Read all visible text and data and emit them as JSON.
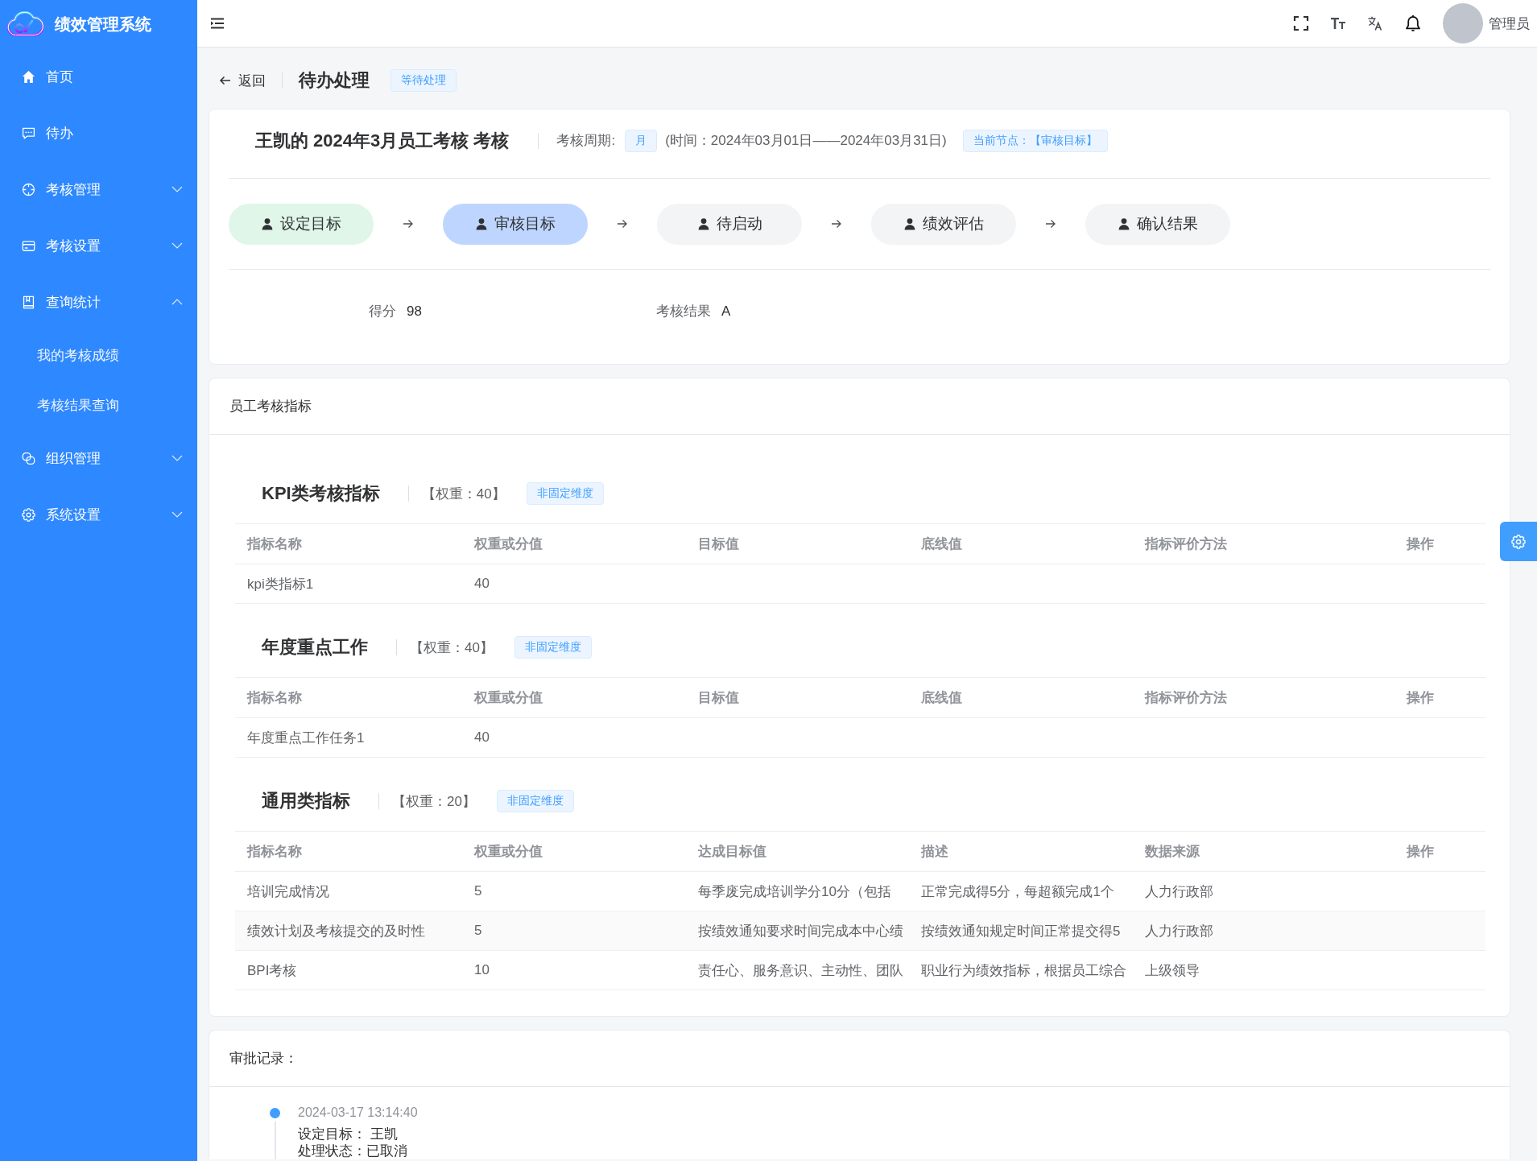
{
  "sidebar": {
    "title": "绩效管理系统",
    "items": [
      {
        "kind": "link",
        "label": "首页"
      },
      {
        "kind": "link",
        "label": "待办"
      },
      {
        "kind": "group",
        "label": "考核管理",
        "expanded": false
      },
      {
        "kind": "group",
        "label": "考核设置",
        "expanded": false
      },
      {
        "kind": "group",
        "label": "查询统计",
        "expanded": true,
        "children": [
          {
            "label": "我的考核成绩"
          },
          {
            "label": "考核结果查询"
          }
        ]
      },
      {
        "kind": "group",
        "label": "组织管理",
        "expanded": false
      },
      {
        "kind": "group",
        "label": "系统设置",
        "expanded": false
      }
    ]
  },
  "top_bar": {
    "user": "管理员"
  },
  "page_header": {
    "back": "返回",
    "title": "待办处理",
    "status": "等待处理"
  },
  "summary": {
    "title": "王凯的 2024年3月员工考核 考核",
    "period_label": "考核周期:",
    "period": "月",
    "time_range": "(时间：2024年03月01日——2024年03月31日)",
    "current_node": "当前节点：【审核目标】",
    "steps": [
      {
        "label": "设定目标",
        "done": true,
        "current": false
      },
      {
        "label": "审核目标",
        "done": false,
        "current": true
      },
      {
        "label": "待启动",
        "done": false,
        "current": false
      },
      {
        "label": "绩效评估",
        "done": false,
        "current": false
      },
      {
        "label": "确认结果",
        "done": false,
        "current": false
      }
    ],
    "fields": [
      {
        "label": "得分",
        "value": "98"
      },
      {
        "label": "考核结果",
        "value": "A"
      }
    ]
  },
  "indicators": {
    "title": "员工考核指标",
    "sections": [
      {
        "title": "KPI类考核指标",
        "weight": "【权重：40】",
        "tag": "非固定维度",
        "columns": [
          "指标名称",
          "权重或分值",
          "目标值",
          "底线值",
          "指标评价方法",
          "操作"
        ],
        "rows": [
          [
            "kpi类指标1",
            "40"
          ]
        ]
      },
      {
        "title": "年度重点工作",
        "weight": "【权重：40】",
        "tag": "非固定维度",
        "columns": [
          "指标名称",
          "权重或分值",
          "目标值",
          "底线值",
          "指标评价方法",
          "操作"
        ],
        "rows": [
          [
            "年度重点工作任务1",
            "40"
          ]
        ]
      },
      {
        "title": "通用类指标",
        "weight": "【权重：20】",
        "tag": "非固定维度",
        "columns": [
          "指标名称",
          "权重或分值",
          "达成目标值",
          "描述",
          "数据来源",
          "操作"
        ],
        "rows": [
          [
            "培训完成情况",
            "5",
            "每季废完成培训学分10分（包括",
            "正常完成得5分，每超额完成1个",
            "人力行政部"
          ],
          [
            "绩效计划及考核提交的及时性",
            "5",
            "按绩效通知要求时间完成本中心绩",
            "按绩效通知规定时间正常提交得5",
            "人力行政部"
          ],
          [
            "BPI考核",
            "10",
            "责任心、服务意识、主动性、团队",
            "职业行为绩效指标，根据员工综合",
            "上级领导"
          ]
        ]
      }
    ]
  },
  "approval": {
    "title": "审批记录：",
    "records": [
      {
        "time": "2024-03-17 13:14:40",
        "lines": [
          "设定目标： 王凯",
          "处理状态：已取消"
        ]
      }
    ]
  }
}
